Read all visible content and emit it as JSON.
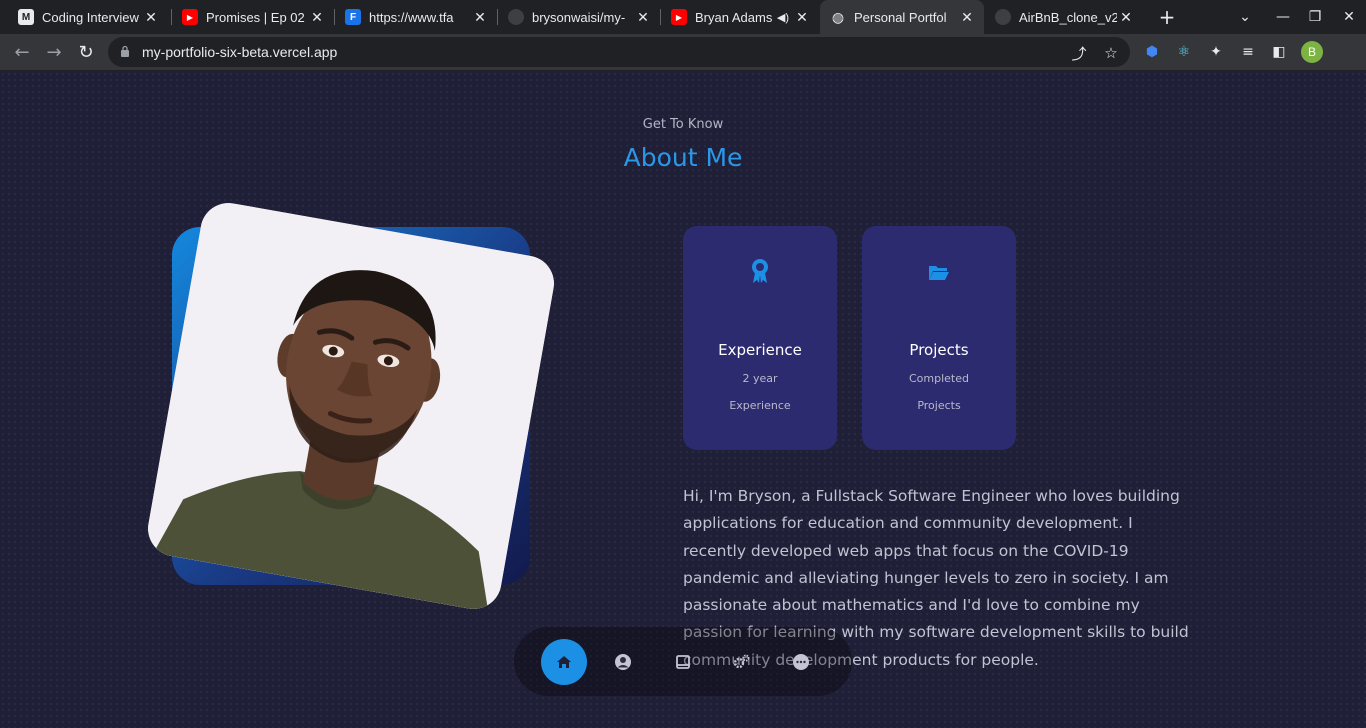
{
  "browser": {
    "tabs": [
      {
        "title": "Coding Interview",
        "icon": "coding-interview-favicon",
        "color": "#e8eaed"
      },
      {
        "title": "Promises | Ep 02",
        "icon": "youtube-favicon",
        "color": "#ff0000"
      },
      {
        "title": "https://www.tfa",
        "icon": "f-logo-favicon",
        "color": "#1a73e8"
      },
      {
        "title": "brysonwaisi/my-",
        "icon": "github-favicon",
        "color": "#e8eaed"
      },
      {
        "title": "Bryan Adams",
        "icon": "youtube-favicon",
        "color": "#ff0000"
      },
      {
        "title": "Personal Portfol",
        "icon": "globe-favicon",
        "color": "#e8eaed"
      },
      {
        "title": "AirBnB_clone_v2",
        "icon": "github-favicon",
        "color": "#e8eaed"
      }
    ],
    "active_tab_index": 5,
    "url": "my-portfolio-six-beta.vercel.app",
    "profile_initial": "B"
  },
  "about": {
    "kicker": "Get To Know",
    "heading": "About Me",
    "cards": [
      {
        "icon": "award-icon",
        "title": "Experience",
        "sub1": "2 year",
        "sub2": "Experience"
      },
      {
        "icon": "folder-open-icon",
        "title": "Projects",
        "sub1": "Completed",
        "sub2": "Projects"
      }
    ],
    "bio": "Hi, I'm Bryson, a Fullstack Software Engineer who loves building applications for education and community development. I recently developed web apps that focus on the COVID-19 pandemic and alleviating hunger levels to zero in society. I am passionate about mathematics and I'd love to combine my passion for learning with my software development skills to build community development products for people."
  },
  "bottom_nav": {
    "items": [
      "home-icon",
      "user-icon",
      "book-icon",
      "services-icon",
      "chat-icon"
    ],
    "active_index": 0
  },
  "colors": {
    "accent": "#2b97e8",
    "card_bg": "#2c2b70",
    "page_bg": "#1f1f38"
  }
}
